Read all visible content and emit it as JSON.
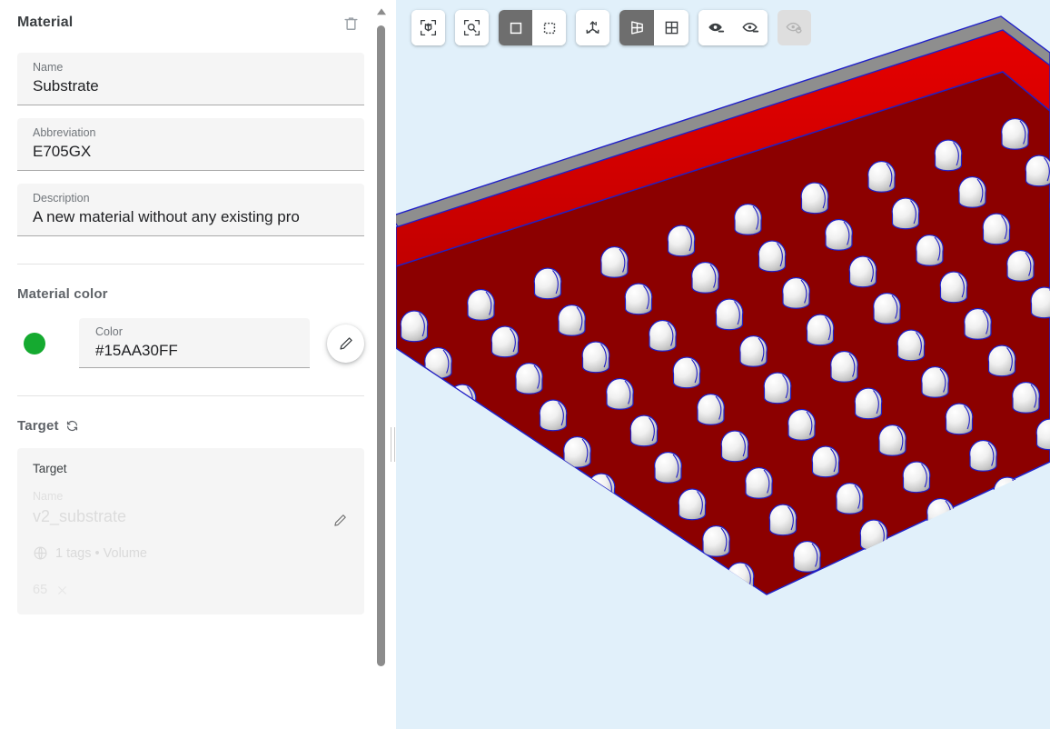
{
  "panel": {
    "title": "Material",
    "delete_icon": "trash-icon",
    "fields": [
      {
        "label": "Name",
        "value": "Substrate"
      },
      {
        "label": "Abbreviation",
        "value": "E705GX"
      },
      {
        "label": "Description",
        "value": "A new material without any existing pro"
      }
    ],
    "material_color": {
      "section_title": "Material color",
      "swatch_hex": "#15AA30",
      "field_label": "Color",
      "field_value": "#15AA30FF",
      "edit_icon": "pencil-icon"
    },
    "target": {
      "section_title": "Target",
      "refresh_icon": "refresh-icon",
      "card_label": "Target",
      "name_label": "Name",
      "name_value": "v2_substrate",
      "meta_icon": "globe-icon",
      "meta_text": "1 tags • Volume",
      "chip_label": "65",
      "chip_remove_icon": "close-icon",
      "edit_icon": "pencil-icon"
    },
    "scrollbar": {
      "up_arrow_icon": "triangle-up-icon"
    }
  },
  "toolbar": {
    "groups": [
      {
        "name": "fit-group",
        "buttons": [
          {
            "name": "fit-to-view-button",
            "icon": "cube-fit-icon",
            "state": "default"
          }
        ]
      },
      {
        "name": "zoom-group",
        "buttons": [
          {
            "name": "zoom-to-selection-button",
            "icon": "magnifier-fit-icon",
            "state": "default"
          }
        ]
      },
      {
        "name": "selection-mode-group",
        "buttons": [
          {
            "name": "select-solid-button",
            "icon": "square-solid-icon",
            "state": "active"
          },
          {
            "name": "select-marquee-button",
            "icon": "square-dashed-icon",
            "state": "default"
          }
        ]
      },
      {
        "name": "axes-group",
        "buttons": [
          {
            "name": "show-axes-button",
            "icon": "axes-icon",
            "state": "default"
          }
        ]
      },
      {
        "name": "view-layout-group",
        "buttons": [
          {
            "name": "perspective-view-button",
            "icon": "perspective-grid-icon",
            "state": "active"
          },
          {
            "name": "orthographic-view-button",
            "icon": "quad-grid-icon",
            "state": "default"
          }
        ]
      },
      {
        "name": "visibility-group",
        "buttons": [
          {
            "name": "hide-selected-button",
            "icon": "eye-minus-filled-icon",
            "state": "default"
          },
          {
            "name": "hide-unselected-button",
            "icon": "eye-minus-outline-icon",
            "state": "default"
          }
        ]
      },
      {
        "name": "restore-visibility-group",
        "buttons": [
          {
            "name": "restore-visibility-button",
            "icon": "eye-refresh-icon",
            "state": "disabled"
          }
        ]
      }
    ]
  },
  "viewport": {
    "name": "3d-viewport",
    "background_hex": "#E1F0FA",
    "model": {
      "name": "substrate-slab-with-solder-balls",
      "slab_top_hex": "#8E8E8E",
      "slab_side_hex": "#E00000",
      "slab_face_hex": "#8E0000",
      "edge_hex": "#2020C8",
      "ball_hex": "#F2F2F2",
      "ball_shadow_hex": "#7A7A7A",
      "ball_rows": 9,
      "ball_cols": 9
    }
  }
}
